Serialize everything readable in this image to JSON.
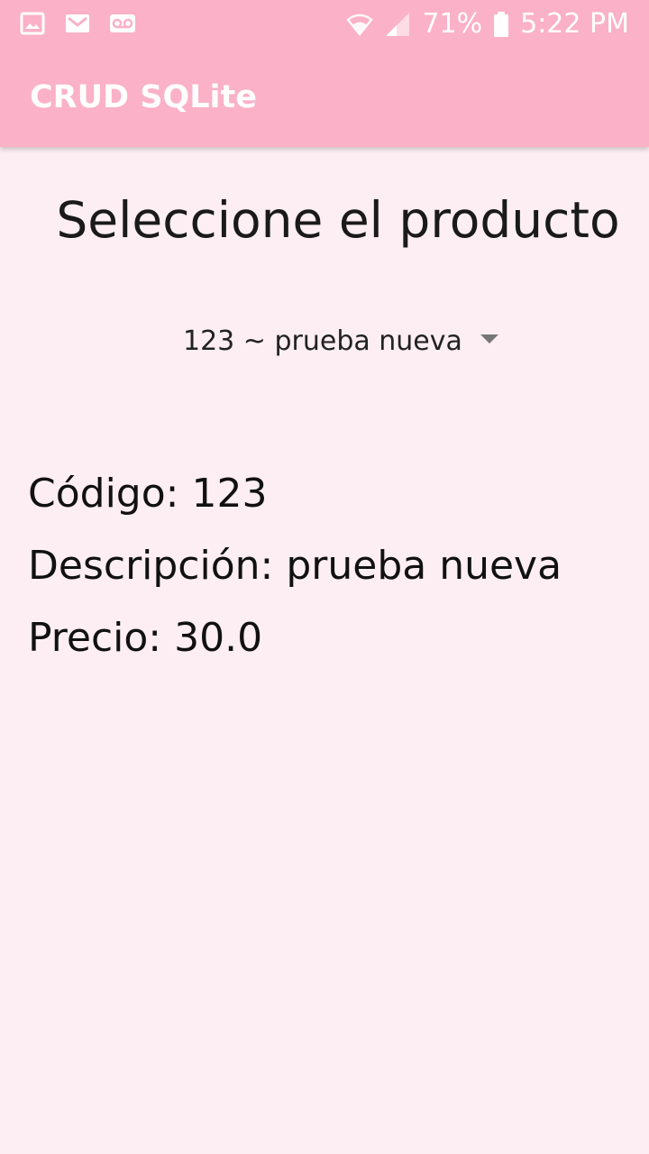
{
  "status_bar": {
    "battery_percent": "71%",
    "time": "5:22 PM",
    "notification_icons": [
      "image-icon",
      "gmail-icon",
      "voicemail-icon"
    ],
    "system_icons": [
      "wifi-icon",
      "signal-icon",
      "battery-icon"
    ]
  },
  "app_bar": {
    "title": "CRUD SQLite",
    "color": "#fbb1c8"
  },
  "main": {
    "heading": "Seleccione el producto",
    "spinner": {
      "selected_value": "123 ~ prueba nueva"
    },
    "details": {
      "codigo": "Código: 123",
      "descripcion": "Descripción: prueba nueva",
      "precio": "Precio: 30.0"
    }
  },
  "colors": {
    "background": "#fdeef3",
    "accent": "#fbb1c8"
  }
}
